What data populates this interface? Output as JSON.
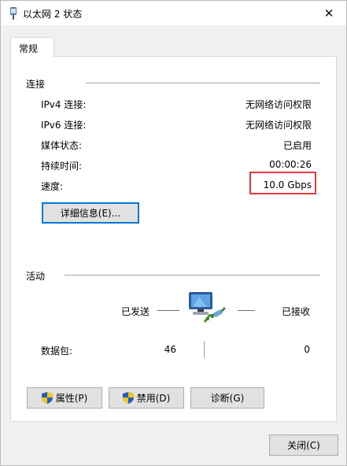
{
  "window": {
    "title": "以太网 2 状态"
  },
  "tabs": [
    {
      "label": "常规"
    }
  ],
  "connection": {
    "heading": "连接",
    "rows": [
      {
        "label": "IPv4 连接:",
        "value": "无网络访问权限"
      },
      {
        "label": "IPv6 连接:",
        "value": "无网络访问权限"
      },
      {
        "label": "媒体状态:",
        "value": "已启用"
      },
      {
        "label": "持续时间:",
        "value": "00:00:26"
      },
      {
        "label": "速度:",
        "value": "10.0 Gbps"
      }
    ],
    "details_button": "详细信息(E)..."
  },
  "activity": {
    "heading": "活动",
    "sent_label": "已发送",
    "received_label": "已接收",
    "packets_label": "数据包:",
    "sent_packets": "46",
    "received_packets": "0"
  },
  "buttons": {
    "properties": "属性(P)",
    "disable": "禁用(D)",
    "diagnose": "诊断(G)",
    "close": "关闭(C)"
  },
  "icons": {
    "title": "network-adapter-icon",
    "activity": "network-computers-icon",
    "shield": "uac-shield-icon"
  },
  "colors": {
    "highlight_border": "#e53935",
    "accent": "#0078d7"
  }
}
